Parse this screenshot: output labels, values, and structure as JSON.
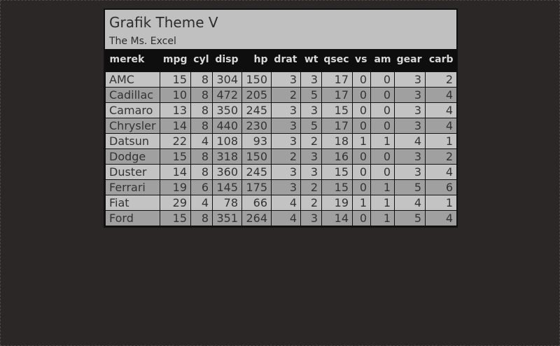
{
  "title": "Grafik Theme V",
  "subtitle": "The Ms. Excel",
  "columns": [
    "merek",
    "mpg",
    "cyl",
    "disp",
    "hp",
    "drat",
    "wt",
    "qsec",
    "vs",
    "am",
    "gear",
    "carb"
  ],
  "rows": [
    [
      "AMC",
      "15",
      "8",
      "304",
      "150",
      "3",
      "3",
      "17",
      "0",
      "0",
      "3",
      "2"
    ],
    [
      "Cadillac",
      "10",
      "8",
      "472",
      "205",
      "2",
      "5",
      "17",
      "0",
      "0",
      "3",
      "4"
    ],
    [
      "Camaro",
      "13",
      "8",
      "350",
      "245",
      "3",
      "3",
      "15",
      "0",
      "0",
      "3",
      "4"
    ],
    [
      "Chrysler",
      "14",
      "8",
      "440",
      "230",
      "3",
      "5",
      "17",
      "0",
      "0",
      "3",
      "4"
    ],
    [
      "Datsun",
      "22",
      "4",
      "108",
      "93",
      "3",
      "2",
      "18",
      "1",
      "1",
      "4",
      "1"
    ],
    [
      "Dodge",
      "15",
      "8",
      "318",
      "150",
      "2",
      "3",
      "16",
      "0",
      "0",
      "3",
      "2"
    ],
    [
      "Duster",
      "14",
      "8",
      "360",
      "245",
      "3",
      "3",
      "15",
      "0",
      "0",
      "3",
      "4"
    ],
    [
      "Ferrari",
      "19",
      "6",
      "145",
      "175",
      "3",
      "2",
      "15",
      "0",
      "1",
      "5",
      "6"
    ],
    [
      "Fiat",
      "29",
      "4",
      "78",
      "66",
      "4",
      "2",
      "19",
      "1",
      "1",
      "4",
      "1"
    ],
    [
      "Ford",
      "15",
      "8",
      "351",
      "264",
      "4",
      "3",
      "14",
      "0",
      "1",
      "5",
      "4"
    ]
  ]
}
